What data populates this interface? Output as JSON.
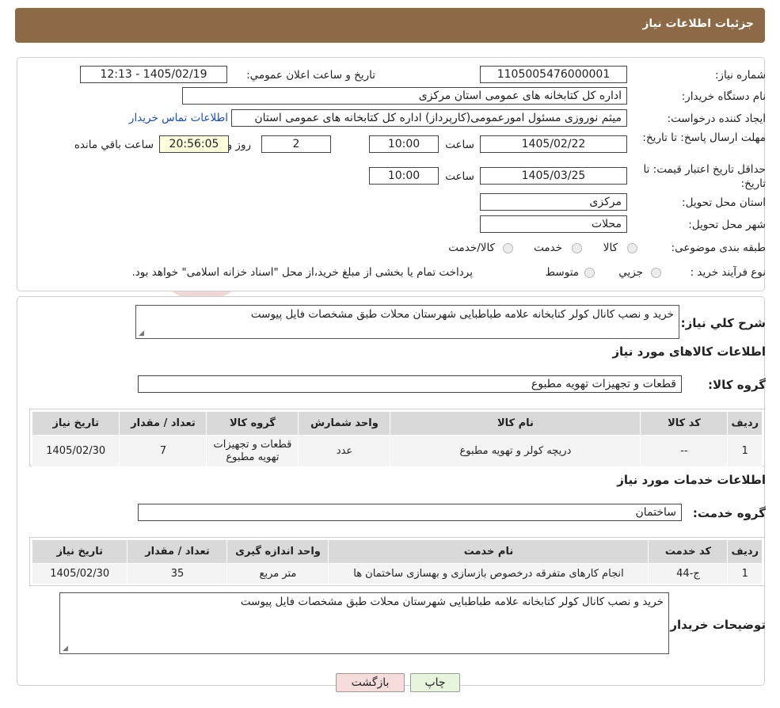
{
  "header": {
    "title": "جزئیات اطلاعات نیاز"
  },
  "fields": {
    "need_number_label": "شماره نیاز:",
    "need_number": "1105005476000001",
    "announce_label": "تاریخ و ساعت اعلان عمومي:",
    "announce_value": "1405/02/19 - 12:13",
    "buyer_label": "نام دستگاه خریدار:",
    "buyer_value": "اداره کل کتابخانه های عمومی استان مرکزی",
    "creator_label": "ایجاد کننده درخواست:",
    "creator_value": "میثم نوروزی مسئول امورعمومی(کارپرداز) اداره کل کتابخانه های عمومی استان",
    "contact_link": "اطلاعات تماس خریدار",
    "deadline_label": "مهلت ارسال پاسخ: تا تاریخ:",
    "deadline_date": "1405/02/22",
    "time_label": "ساعت",
    "deadline_time": "10:00",
    "days_value": "2",
    "days_label": "روز و",
    "remaining_value": "20:56:05",
    "remaining_label": "ساعت باقي مانده",
    "validity_label": "حداقل تاریخ اعتبار قیمت: تا تاریخ:",
    "validity_date": "1405/03/25",
    "validity_time": "10:00",
    "province_label": "استان محل تحویل:",
    "province_value": "مرکزی",
    "city_label": "شهر محل تحویل:",
    "city_value": "محلات",
    "category_label": "طبقه بندی موضوعی:",
    "category_options": [
      "کالا",
      "خدمت",
      "کالا/خدمت"
    ],
    "process_label": "نوع فرآیند خرید :",
    "process_options": [
      "جزیي",
      "متوسط"
    ],
    "process_note": "پرداخت تمام یا بخشی از مبلغ خرید،از محل \"اسناد خزانه اسلامی\" خواهد بود."
  },
  "description": {
    "label": "شرح کلي نیاز:",
    "value": "خرید و نصب کانال کولر کتابخانه علامه طباطبایی شهرستان محلات طبق مشخصات فایل پیوست"
  },
  "goods": {
    "section_title": "اطلاعات کالاهای مورد نیاز",
    "group_label": "گروه کالا:",
    "group_value": "قطعات و تجهیزات تهویه مطبوع",
    "columns": [
      "ردیف",
      "کد کالا",
      "نام کالا",
      "واحد شمارش",
      "گروه کالا",
      "تعداد / مقدار",
      "تاریخ نیاز"
    ],
    "rows": [
      [
        "1",
        "--",
        "دریچه کولر و تهویه مطبوع",
        "عدد",
        "قطعات و تجهیزات تهویه مطبوع",
        "7",
        "1405/02/30"
      ]
    ]
  },
  "services": {
    "section_title": "اطلاعات خدمات مورد نیاز",
    "group_label": "گروه خدمت:",
    "group_value": "ساختمان",
    "columns": [
      "ردیف",
      "کد خدمت",
      "نام خدمت",
      "واحد اندازه گیری",
      "تعداد / مقدار",
      "تاریخ نیاز"
    ],
    "rows": [
      [
        "1",
        "ج-44",
        "انجام کارهای متفرقه درخصوص بازسازی و بهسازی ساختمان ها",
        "متر مربع",
        "35",
        "1405/02/30"
      ]
    ]
  },
  "buyer_notes": {
    "label": "توضیحات خریدار:",
    "value": "خرید و نصب کانال کولر کتابخانه علامه طباطبایی شهرستان محلات طبق مشخصات فایل پیوست"
  },
  "buttons": {
    "print": "چاپ",
    "back": "بازگشت"
  },
  "watermark": {
    "text": "AriaTender.neT"
  },
  "colors": {
    "header": "#8b6a45",
    "link": "#1a4dbb",
    "remaining_bg": "#ffffdd",
    "back_button": "#f7dcdc",
    "print_button": "#e6f5dc"
  }
}
